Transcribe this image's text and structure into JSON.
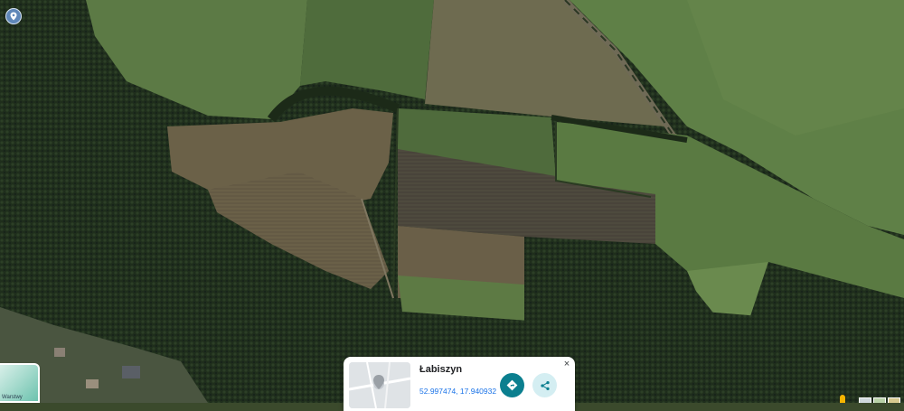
{
  "map": {
    "view": "satellite"
  },
  "location_card": {
    "title": "Łabiszyn",
    "coordinates": "52.997474, 17.940932",
    "close_label": "×"
  },
  "layers": {
    "label": "Warstwy"
  },
  "colors": {
    "directions": "#0b7f8f",
    "share_bg": "#d4eef2",
    "coords_link": "#1a73e8"
  },
  "icons": {
    "location": "location-icon",
    "directions": "directions-icon",
    "share": "share-icon",
    "close": "close-icon",
    "pegman": "pegman-icon"
  }
}
